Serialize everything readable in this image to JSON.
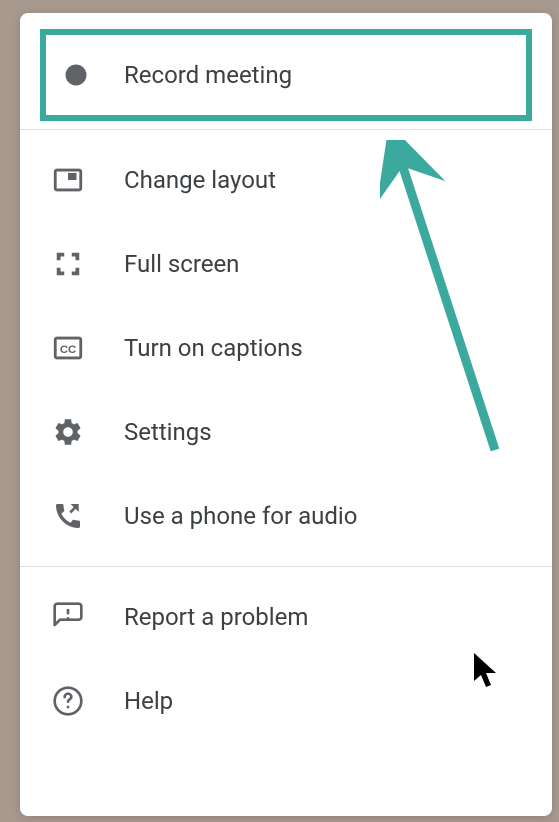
{
  "menu": {
    "items": [
      {
        "label": "Record meeting",
        "highlighted": true
      },
      {
        "label": "Change layout"
      },
      {
        "label": "Full screen"
      },
      {
        "label": "Turn on captions"
      },
      {
        "label": "Settings"
      },
      {
        "label": "Use a phone for audio"
      },
      {
        "label": "Report a problem"
      },
      {
        "label": "Help"
      }
    ]
  },
  "annotations": {
    "arrow_color": "#3ca99e"
  }
}
